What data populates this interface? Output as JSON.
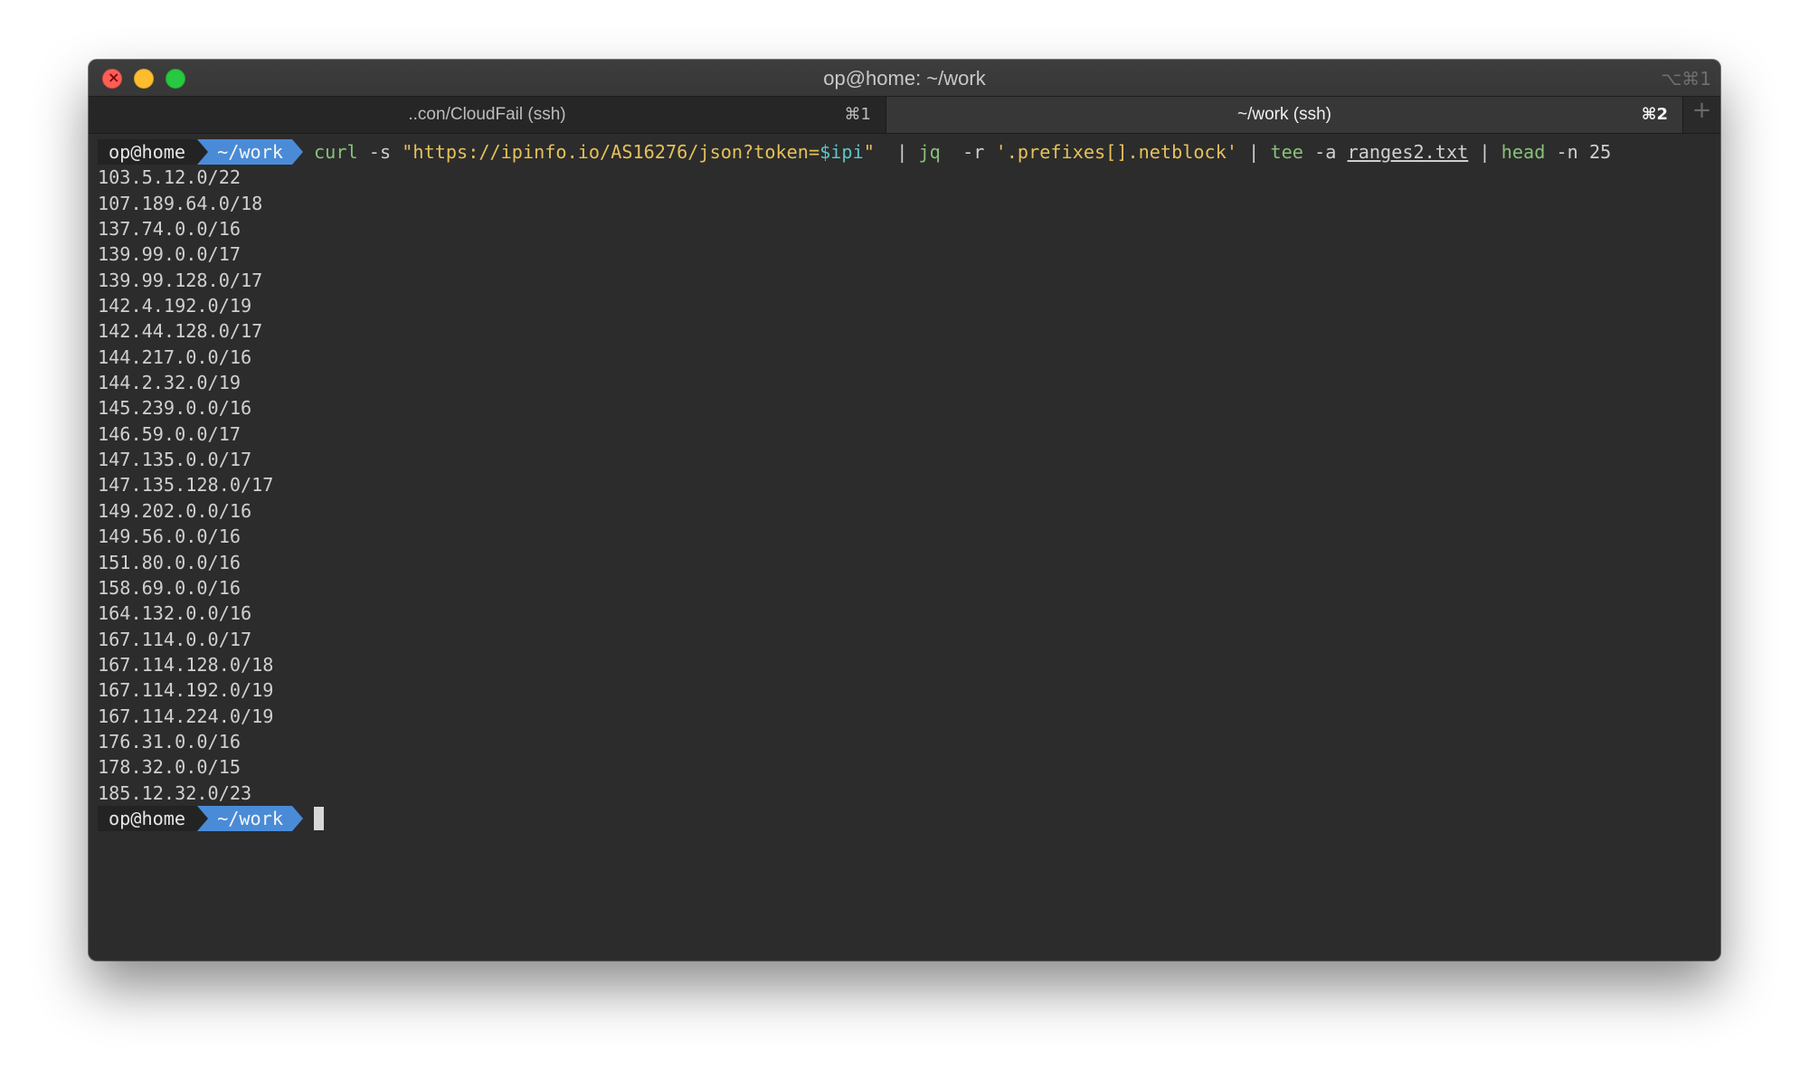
{
  "window": {
    "title": "op@home: ~/work",
    "shortcut": "⌥⌘1"
  },
  "tabs": [
    {
      "label": "..con/CloudFail (ssh)",
      "key": "⌘1",
      "active": false
    },
    {
      "label": "~/work (ssh)",
      "key": "⌘2",
      "active": true
    }
  ],
  "new_tab_label": "+",
  "prompt": {
    "user": "op@home",
    "dir": "~/work"
  },
  "command": {
    "curl": "curl",
    "curl_flag": " -s ",
    "url_part": "\"https://ipinfo.io/AS16276/json?token=",
    "url_var": "$ipi",
    "url_end": "\"",
    "pipe1": "  | ",
    "jq": "jq",
    "jq_flag": "  -r ",
    "jq_filter": "'.prefixes[].netblock'",
    "pipe2": " | ",
    "tee": "tee",
    "tee_flag": " -a ",
    "tee_file": "ranges2.txt",
    "pipe3": " | ",
    "head": "head",
    "head_flag": " -n 25"
  },
  "output": [
    "103.5.12.0/22",
    "107.189.64.0/18",
    "137.74.0.0/16",
    "139.99.0.0/17",
    "139.99.128.0/17",
    "142.4.192.0/19",
    "142.44.128.0/17",
    "144.217.0.0/16",
    "144.2.32.0/19",
    "145.239.0.0/16",
    "146.59.0.0/17",
    "147.135.0.0/17",
    "147.135.128.0/17",
    "149.202.0.0/16",
    "149.56.0.0/16",
    "151.80.0.0/16",
    "158.69.0.0/16",
    "164.132.0.0/16",
    "167.114.0.0/17",
    "167.114.128.0/18",
    "167.114.192.0/19",
    "167.114.224.0/19",
    "176.31.0.0/16",
    "178.32.0.0/15",
    "185.12.32.0/23"
  ],
  "colors": {
    "terminal_bg": "#2c2c2c",
    "prompt_dir_bg": "#4a8bd8",
    "command": "#8ac07a",
    "string": "#e6c15a",
    "variable": "#5fc4c8"
  }
}
